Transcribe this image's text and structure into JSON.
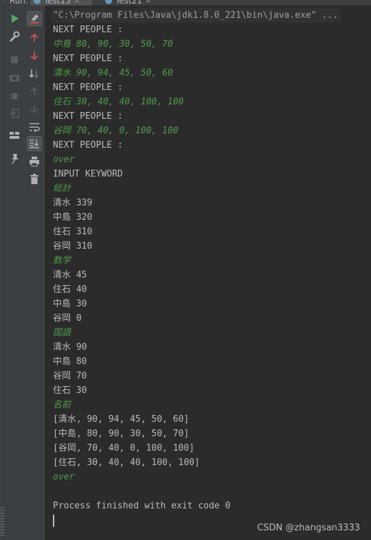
{
  "topbar": {
    "run_label": "Run:",
    "tabs": [
      {
        "label": "Test15",
        "active": true
      },
      {
        "label": "Test21",
        "active": false
      }
    ]
  },
  "toolbar": {
    "col1": [
      "rerun-icon",
      "wrench-icon",
      "stop-icon",
      "camera-icon",
      "bug-icon",
      "exit-icon",
      "layout-icon",
      "pin-icon"
    ],
    "col2": [
      "clear-icon",
      "up-arrow-icon",
      "down-arrow-icon",
      "sort-icon",
      "up-arrow-disabled-icon",
      "down-arrow-disabled-icon",
      "soft-wrap-icon",
      "scroll-to-end-icon",
      "print-icon",
      "trash-icon"
    ]
  },
  "console": {
    "command": "\"C:\\Program Files\\Java\\jdk1.8.0_221\\bin\\java.exe\" ...",
    "lines": [
      {
        "text": "NEXT PEOPLE :",
        "kind": "out"
      },
      {
        "text": "中島 80, 90, 30, 50, 70",
        "kind": "input"
      },
      {
        "text": "NEXT PEOPLE :",
        "kind": "out"
      },
      {
        "text": "清水 90, 94, 45, 50, 60",
        "kind": "input"
      },
      {
        "text": "NEXT PEOPLE :",
        "kind": "out"
      },
      {
        "text": "住石 30, 40, 40, 100, 100",
        "kind": "input"
      },
      {
        "text": "NEXT PEOPLE :",
        "kind": "out"
      },
      {
        "text": "谷岡 70, 40, 0, 100, 100",
        "kind": "input"
      },
      {
        "text": "NEXT PEOPLE :",
        "kind": "out"
      },
      {
        "text": "over",
        "kind": "input"
      },
      {
        "text": "INPUT KEYWORD",
        "kind": "out"
      },
      {
        "text": "総計",
        "kind": "input"
      },
      {
        "text": "清水 339",
        "kind": "out"
      },
      {
        "text": "中島 320",
        "kind": "out"
      },
      {
        "text": "住石 310",
        "kind": "out"
      },
      {
        "text": "谷岡 310",
        "kind": "out"
      },
      {
        "text": "数学",
        "kind": "input"
      },
      {
        "text": "清水 45",
        "kind": "out"
      },
      {
        "text": "住石 40",
        "kind": "out"
      },
      {
        "text": "中島 30",
        "kind": "out"
      },
      {
        "text": "谷岡 0",
        "kind": "out"
      },
      {
        "text": "国語",
        "kind": "input"
      },
      {
        "text": "清水 90",
        "kind": "out"
      },
      {
        "text": "中島 80",
        "kind": "out"
      },
      {
        "text": "谷岡 70",
        "kind": "out"
      },
      {
        "text": "住石 30",
        "kind": "out"
      },
      {
        "text": "名前",
        "kind": "input"
      },
      {
        "text": "[清水, 90, 94, 45, 50, 60]",
        "kind": "out"
      },
      {
        "text": "[中島, 80, 90, 30, 50, 70]",
        "kind": "out"
      },
      {
        "text": "[谷岡, 70, 40, 0, 100, 100]",
        "kind": "out"
      },
      {
        "text": "[住石, 30, 40, 40, 100, 100]",
        "kind": "out"
      },
      {
        "text": "over",
        "kind": "input"
      },
      {
        "text": "",
        "kind": "out"
      },
      {
        "text": "Process finished with exit code 0",
        "kind": "exit"
      }
    ]
  },
  "watermark": "CSDN @zhangsan3333",
  "colors": {
    "background": "#2b2b2b",
    "toolbar": "#3c3f41",
    "output_text": "#bbbbbb",
    "user_input": "#4f9b4a",
    "run_green": "#59a869",
    "red_accent": "#c75450"
  }
}
